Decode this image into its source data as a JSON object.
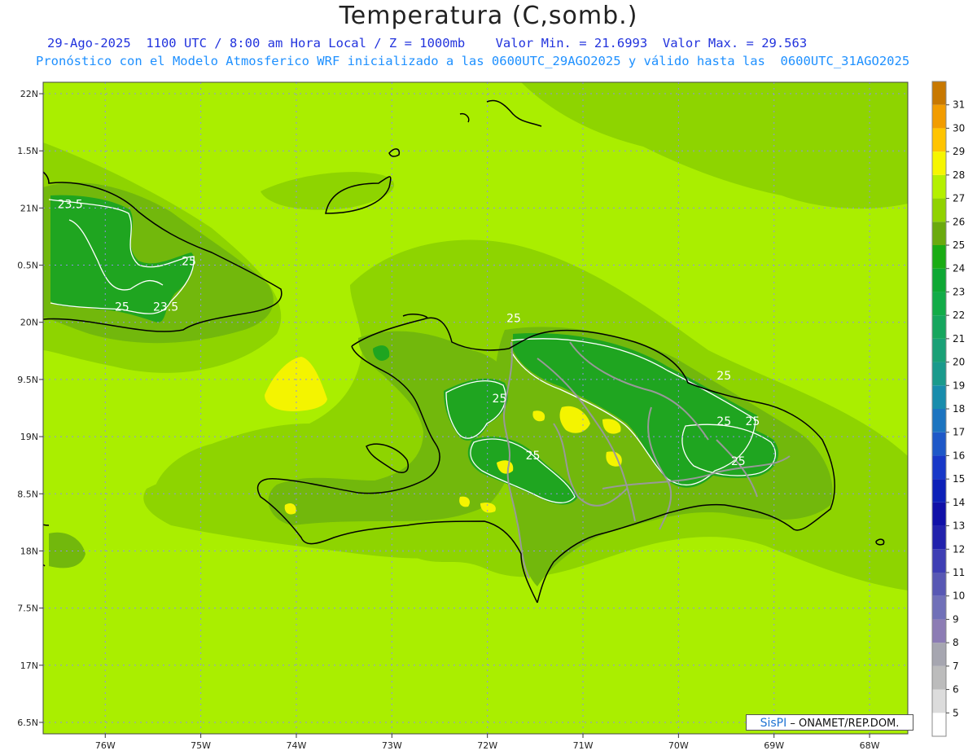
{
  "title": "Temperatura (C,somb.)",
  "subtitle_line1": "29-Ago-2025  1100 UTC / 8:00 am Hora Local / Z = 1000mb    Valor Min. = 21.6993  Valor Max. = 29.563",
  "subtitle_line2": "Pronóstico con el Modelo Atmosferico WRF inicializado a las 0600UTC_29AGO2025 y válido hasta las  0600UTC_31AGO2025",
  "credit": {
    "brand": "SisPI",
    "text": " – ONAMET/REP.DOM."
  },
  "map": {
    "lat_range": [
      16.4,
      22.1
    ],
    "lon_range": [
      -76.65,
      -67.6
    ],
    "lat_labels": [
      {
        "lat": 22.0,
        "label": "22N"
      },
      {
        "lat": 21.5,
        "label": "1.5N"
      },
      {
        "lat": 21.0,
        "label": "21N"
      },
      {
        "lat": 20.5,
        "label": "0.5N"
      },
      {
        "lat": 20.0,
        "label": "20N"
      },
      {
        "lat": 19.5,
        "label": "9.5N"
      },
      {
        "lat": 19.0,
        "label": "19N"
      },
      {
        "lat": 18.5,
        "label": "8.5N"
      },
      {
        "lat": 18.0,
        "label": "18N"
      },
      {
        "lat": 17.5,
        "label": "7.5N"
      },
      {
        "lat": 17.0,
        "label": "17N"
      },
      {
        "lat": 16.5,
        "label": "6.5N"
      }
    ],
    "lon_labels": [
      {
        "lon": -76,
        "label": "76W"
      },
      {
        "lon": -75,
        "label": "75W"
      },
      {
        "lon": -74,
        "label": "74W"
      },
      {
        "lon": -73,
        "label": "73W"
      },
      {
        "lon": -72,
        "label": "72W"
      },
      {
        "lon": -71,
        "label": "71W"
      },
      {
        "lon": -70,
        "label": "70W"
      },
      {
        "lon": -69,
        "label": "69W"
      },
      {
        "lon": -68,
        "label": "68W"
      }
    ],
    "contour_labels": [
      {
        "lon": -76.5,
        "lat": 21.0,
        "text": "23.5"
      },
      {
        "lon": -75.2,
        "lat": 20.5,
        "text": "25"
      },
      {
        "lon": -75.9,
        "lat": 20.1,
        "text": "25"
      },
      {
        "lon": -75.5,
        "lat": 20.1,
        "text": "23.5"
      },
      {
        "lon": -71.8,
        "lat": 20.0,
        "text": "25"
      },
      {
        "lon": -71.95,
        "lat": 19.3,
        "text": "25"
      },
      {
        "lon": -69.6,
        "lat": 19.5,
        "text": "25"
      },
      {
        "lon": -69.6,
        "lat": 19.1,
        "text": "25"
      },
      {
        "lon": -69.3,
        "lat": 19.1,
        "text": "25"
      },
      {
        "lon": -71.6,
        "lat": 18.8,
        "text": "25"
      },
      {
        "lon": -69.45,
        "lat": 18.75,
        "text": "25"
      }
    ]
  },
  "colorbar": {
    "labels": [
      "5",
      "6",
      "7",
      "8",
      "9",
      "10",
      "11",
      "12",
      "13",
      "14",
      "15",
      "16",
      "17",
      "18",
      "19",
      "20",
      "21",
      "22",
      "23",
      "24",
      "25",
      "26",
      "27",
      "28",
      "29",
      "30",
      "31"
    ],
    "colors": [
      "#ffffff",
      "#dcdcdc",
      "#bcbcbc",
      "#a6a6b0",
      "#8c7cb4",
      "#7070b8",
      "#5858b4",
      "#3e3eb4",
      "#2222ac",
      "#1010a8",
      "#0c20b8",
      "#1838c8",
      "#1e58c8",
      "#1c74c0",
      "#188cac",
      "#1a9a8c",
      "#1aa076",
      "#16a65e",
      "#12ac48",
      "#0ea834",
      "#1aac14",
      "#6aaa0e",
      "#90d200",
      "#b4f000",
      "#f6f600",
      "#ffc400",
      "#f29c00",
      "#c87800"
    ],
    "colors_note": ""
  },
  "colors": {
    "field_27": "#aaee00",
    "field_26": "#8ed400",
    "field_25": "#72b80c",
    "field_24": "#1fa520",
    "field_28": "#f4f400",
    "coast": "#000000",
    "border": "#999999",
    "grid": "#8f8fe8"
  }
}
